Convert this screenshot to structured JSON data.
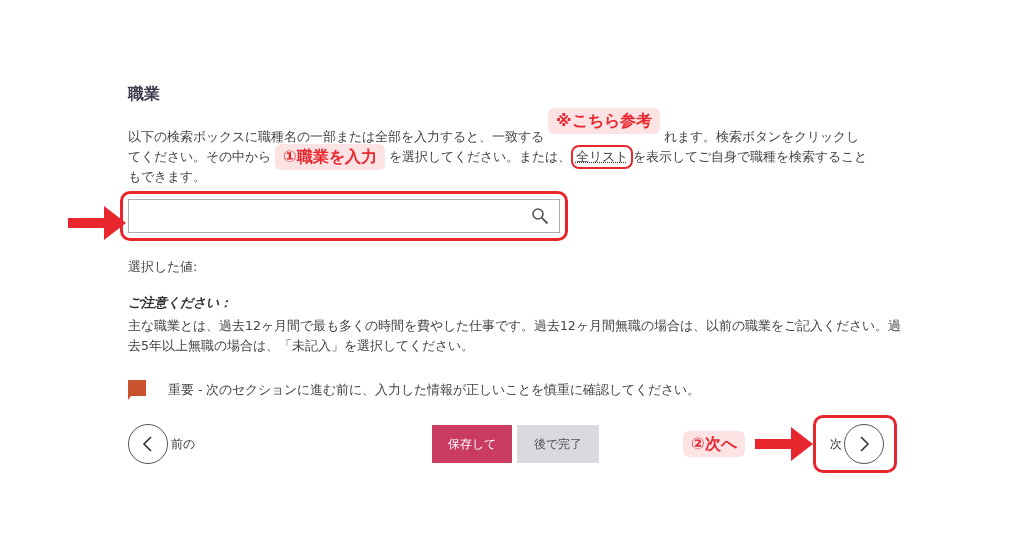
{
  "heading": "職業",
  "description_lines": [
    [
      {
        "kind": "text",
        "text": "以下の検索ボックスに職種名の一部または全部を入力すると、一致する"
      },
      {
        "kind": "callout",
        "text": "※こちら参考",
        "raised": true
      },
      {
        "kind": "text",
        "text": "れます。検索ボタンをクリックし"
      }
    ],
    [
      {
        "kind": "text",
        "text": "てください。その中から"
      },
      {
        "kind": "callout",
        "text": "①職業を入力",
        "raised": false
      },
      {
        "kind": "text",
        "text": "を選択してください。または、"
      },
      {
        "kind": "link",
        "text": "全リスト",
        "circled": true
      },
      {
        "kind": "text",
        "text": "を表示してご自身で職種を検索すること"
      }
    ],
    [
      {
        "kind": "text",
        "text": "もできます。"
      }
    ]
  ],
  "search": {
    "highlighted": true
  },
  "selected_value_label": "選択した値:",
  "notice": {
    "title": "ご注意ください：",
    "body": "主な職業とは、過去12ヶ月間で最も多くの時間を費やした仕事です。過去12ヶ月間無職の場合は、以前の職業をご記入ください。過去5年以上無職の場合は、「未記入」を選択してください。"
  },
  "important": "重要 - 次のセクションに進む前に、入力した情報が正しいことを慎重に確認してください。",
  "nav": {
    "prev_label": "前の",
    "save": "保存して",
    "later": "後で完了",
    "next_callout": "②次へ",
    "next_label": "次",
    "next_highlighted": true
  }
}
